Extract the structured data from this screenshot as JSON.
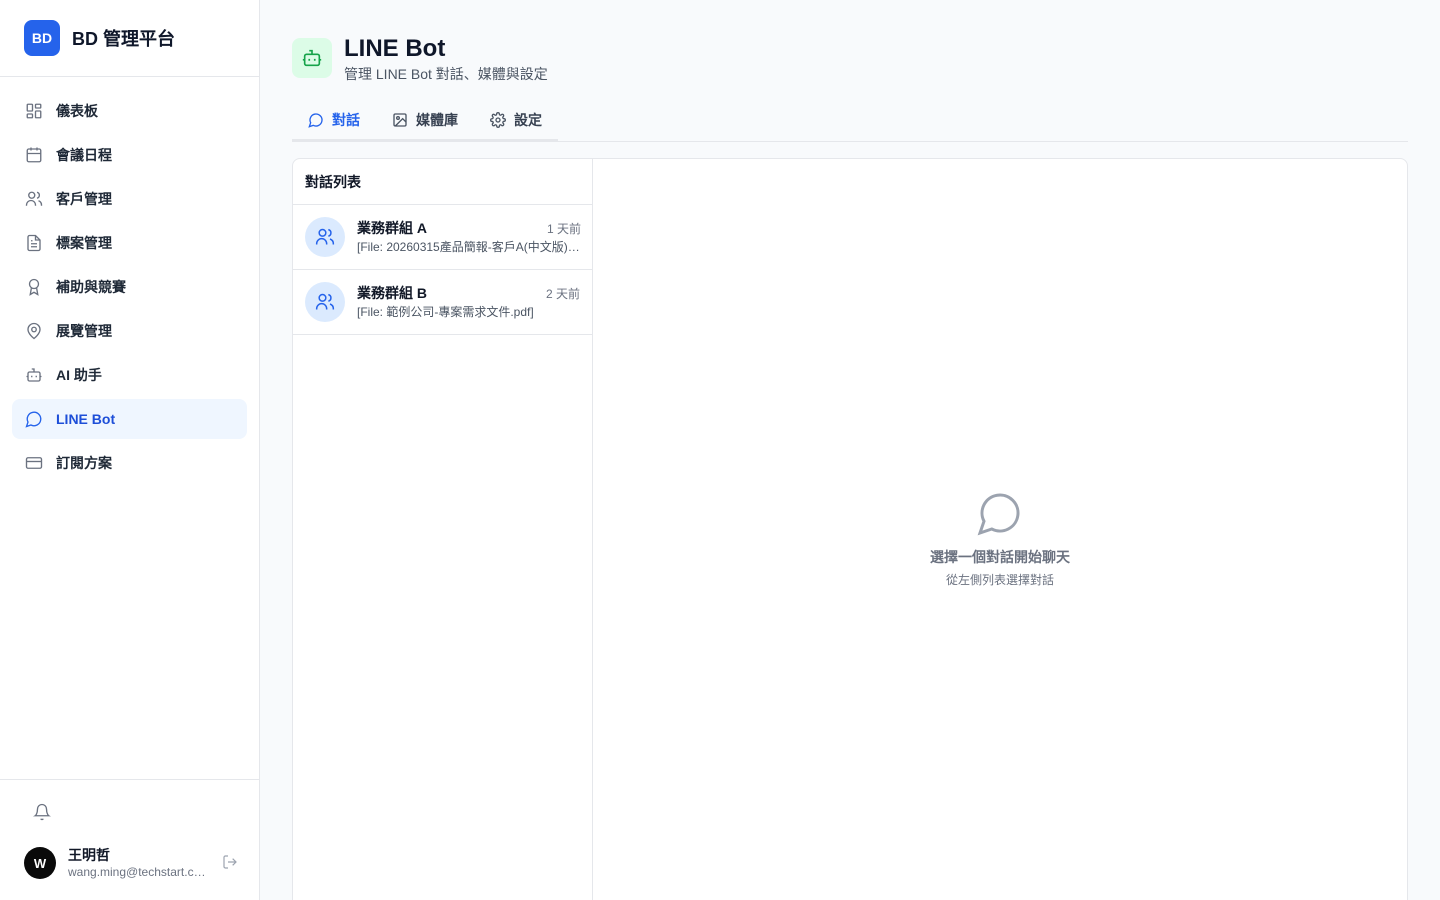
{
  "brand": {
    "logo": "BD",
    "name": "BD 管理平台",
    "accent": "#2563eb"
  },
  "nav": [
    {
      "label": "儀表板",
      "icon": "dashboard-icon"
    },
    {
      "label": "會議日程",
      "icon": "calendar-icon"
    },
    {
      "label": "客戶管理",
      "icon": "users-icon"
    },
    {
      "label": "標案管理",
      "icon": "document-icon"
    },
    {
      "label": "補助與競賽",
      "icon": "award-icon"
    },
    {
      "label": "展覽管理",
      "icon": "map-pin-icon"
    },
    {
      "label": "AI 助手",
      "icon": "bot-icon"
    },
    {
      "label": "LINE Bot",
      "icon": "message-circle-icon",
      "active": true
    },
    {
      "label": "訂閱方案",
      "icon": "credit-card-icon"
    }
  ],
  "user": {
    "initial": "W",
    "name": "王明哲",
    "email": "wang.ming@techstart.com"
  },
  "header": {
    "title": "LINE Bot",
    "subtitle": "管理 LINE Bot 對話、媒體與設定"
  },
  "tabs": [
    {
      "label": "對話",
      "icon": "message-circle-icon",
      "active": true
    },
    {
      "label": "媒體庫",
      "icon": "image-icon"
    },
    {
      "label": "設定",
      "icon": "gear-icon"
    }
  ],
  "conversations": {
    "heading": "對話列表",
    "items": [
      {
        "name": "業務群組 A",
        "time": "1 天前",
        "preview": "[File: 20260315產品簡報-客戶A(中文版).pdf]"
      },
      {
        "name": "業務群組 B",
        "time": "2 天前",
        "preview": "[File: 範例公司-專案需求文件.pdf]"
      }
    ]
  },
  "empty_state": {
    "title": "選擇一個對話開始聊天",
    "subtitle": "從左側列表選擇對話"
  }
}
